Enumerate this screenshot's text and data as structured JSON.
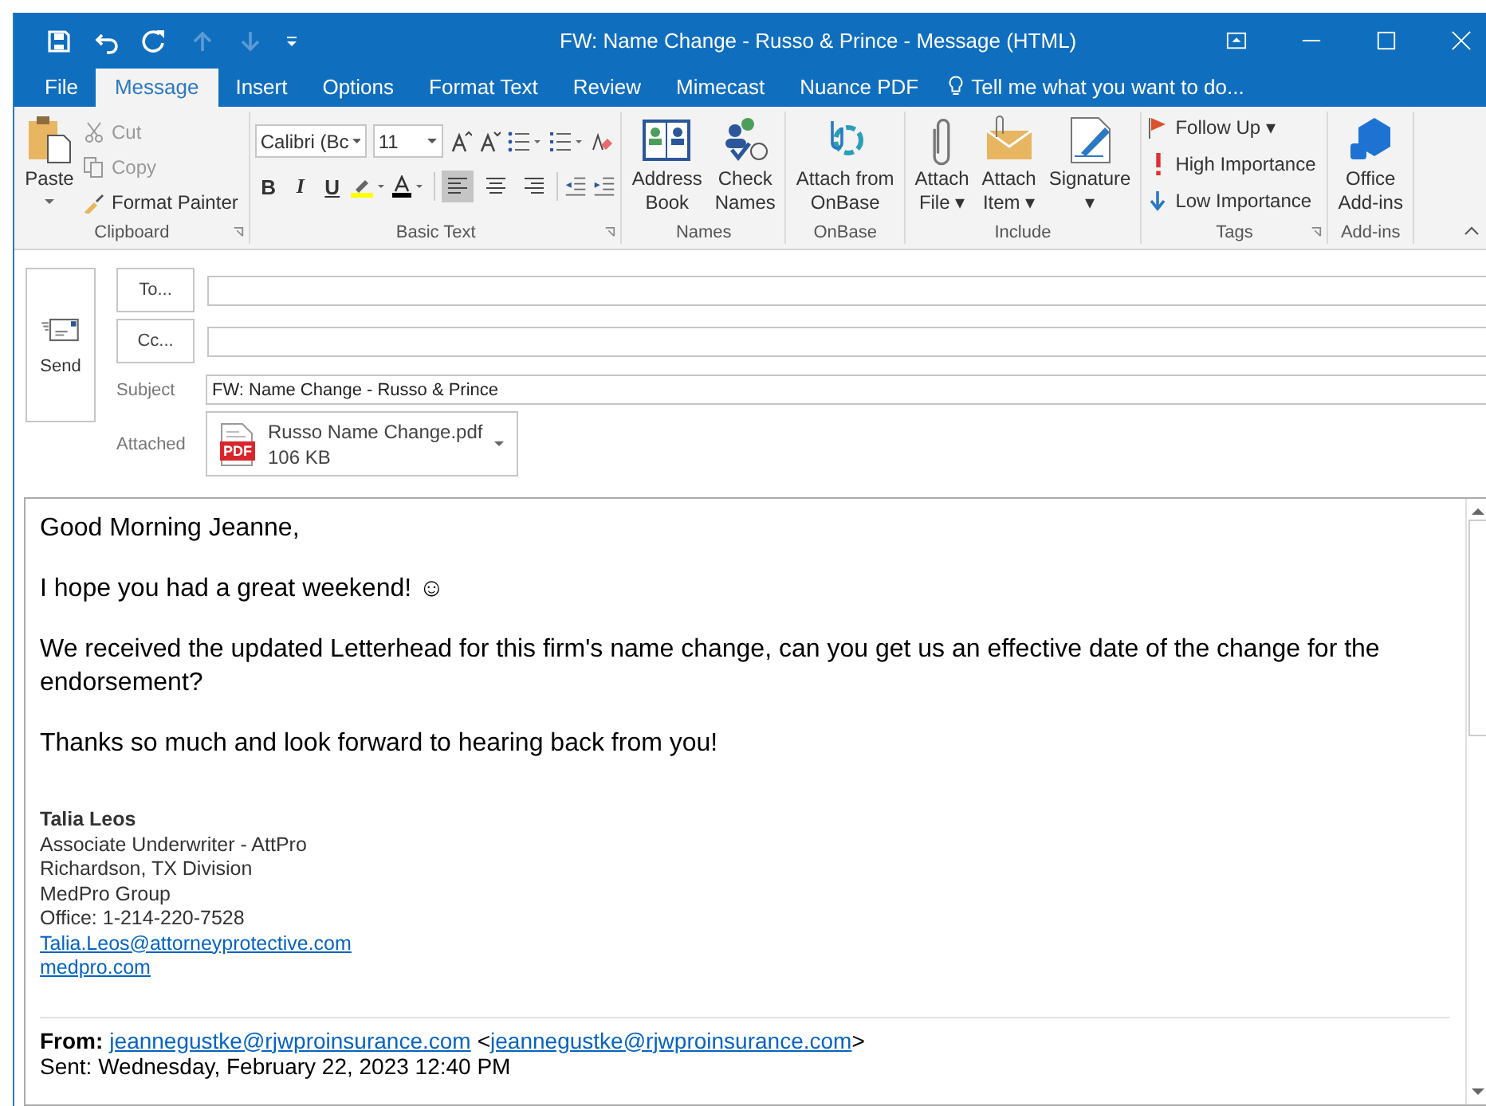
{
  "window": {
    "title": "FW: Name Change - Russo & Prince - Message (HTML)"
  },
  "tabs": [
    {
      "label": "File",
      "selected": false
    },
    {
      "label": "Message",
      "selected": true
    },
    {
      "label": "Insert",
      "selected": false
    },
    {
      "label": "Options",
      "selected": false
    },
    {
      "label": "Format Text",
      "selected": false
    },
    {
      "label": "Review",
      "selected": false
    },
    {
      "label": "Mimecast",
      "selected": false
    },
    {
      "label": "Nuance PDF",
      "selected": false
    }
  ],
  "tell_me": {
    "placeholder": "Tell me what you want to do..."
  },
  "ribbon": {
    "clipboard": {
      "label": "Clipboard",
      "paste": "Paste",
      "items": [
        {
          "kind": "cut",
          "label": "Cut",
          "disabled": true
        },
        {
          "kind": "copy",
          "label": "Copy",
          "disabled": true
        },
        {
          "kind": "painter",
          "label": "Format Painter",
          "disabled": false
        }
      ]
    },
    "basic_text": {
      "label": "Basic Text",
      "font": "Calibri (Bc",
      "size": "11",
      "format_buttons": [
        {
          "kind": "bold",
          "label": "B"
        },
        {
          "kind": "italic",
          "label": "I"
        },
        {
          "kind": "underline",
          "label": "U"
        }
      ],
      "alignments": [
        {
          "kind": "left",
          "selected": true
        },
        {
          "kind": "center",
          "selected": false
        },
        {
          "kind": "right",
          "selected": false
        }
      ]
    },
    "names": {
      "label": "Names",
      "buttons": [
        {
          "kind": "book",
          "lines": [
            "Address",
            "Book"
          ]
        },
        {
          "kind": "check",
          "lines": [
            "Check",
            "Names"
          ]
        }
      ]
    },
    "onbase": {
      "label": "OnBase",
      "buttons": [
        {
          "kind": "onbase",
          "lines": [
            "Attach from",
            "OnBase"
          ]
        }
      ]
    },
    "include": {
      "label": "Include",
      "buttons": [
        {
          "kind": "clip",
          "lines": [
            "Attach",
            "File ▾"
          ]
        },
        {
          "kind": "envelope",
          "lines": [
            "Attach",
            "Item ▾"
          ]
        },
        {
          "kind": "signature",
          "lines": [
            "Signature",
            "▾"
          ]
        }
      ]
    },
    "tags": {
      "label": "Tags",
      "items": [
        {
          "kind": "flag",
          "label": "Follow Up ▾"
        },
        {
          "kind": "high",
          "label": "High Importance"
        },
        {
          "kind": "low",
          "label": "Low Importance"
        }
      ]
    },
    "addins": {
      "label": "Add-ins",
      "buttons": [
        {
          "kind": "office",
          "lines": [
            "Office",
            "Add-ins"
          ]
        }
      ]
    }
  },
  "compose": {
    "send": "Send",
    "to_button": "To...",
    "cc_button": "Cc...",
    "subject_label": "Subject",
    "subject": "FW: Name Change - Russo & Prince",
    "attached_label": "Attached",
    "attachment": {
      "badge": "PDF",
      "name": "Russo Name Change.pdf",
      "size": "106 KB"
    }
  },
  "body": {
    "paragraphs": [
      "Good Morning Jeanne,",
      "I hope you had a great weekend! ☺",
      "We received the updated Letterhead for this firm's name change, can you get us an effective date of the change for the endorsement?",
      "Thanks so much and look forward to hearing back from you!"
    ],
    "signature": {
      "name": "Talia Leos",
      "lines": [
        "Associate Underwriter - AttPro",
        "Richardson, TX Division",
        "MedPro Group",
        "Office: 1-214-220-7528"
      ],
      "links": [
        "Talia.Leos@attorneyprotective.com",
        "medpro.com"
      ]
    },
    "from": {
      "label": "From:",
      "email": "jeannegustke@rjwproinsurance.com",
      "lt": "<",
      "email2": "jeannegustke@rjwproinsurance.com",
      "gt": ">"
    },
    "sent": "Sent: Wednesday, February 22, 2023 12:40 PM"
  }
}
